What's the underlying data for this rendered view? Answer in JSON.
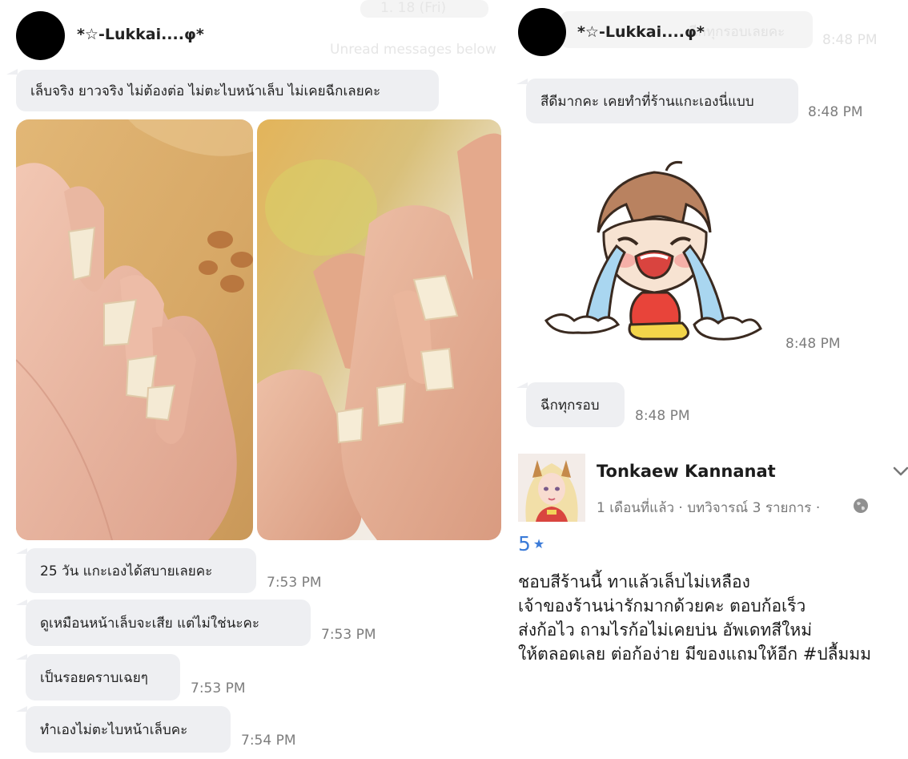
{
  "left_chat": {
    "ghost_date": "1. 18 (Fri)",
    "ghost_unread": "Unread messages below",
    "sender_name": "*☆-Lukkai....φ*",
    "first_message": "เล็บจริง ยาวจริง ไม่ต้องต่อ ไม่ตะไบหน้าเล็บ ไม่เคยฉีกเลยคะ",
    "messages": [
      {
        "text": "25 วัน แกะเองได้สบายเลยคะ",
        "time": "7:53 PM"
      },
      {
        "text": "ดูเหมือนหน้าเล็บจะเสีย แต่ไม่ใช่นะคะ",
        "time": "7:53 PM"
      },
      {
        "text": "เป็นรอยคราบเฉยๆ",
        "time": "7:53 PM"
      },
      {
        "text": "ทำเองไม่ตะไบหน้าเล็บคะ",
        "time": "7:54 PM"
      }
    ]
  },
  "right_chat": {
    "ghost_text": "ฉีกทุกรอบเลยคะ",
    "ghost_time": "8:48 PM",
    "sender_name": "*☆-Lukkai....φ*",
    "messages": [
      {
        "text": "สีดีมากคะ เคยทำที่ร้านแกะเองนี่แบบ",
        "time": "8:48 PM"
      },
      {
        "text": "ฉีกทุกรอบ",
        "time": "8:48 PM"
      }
    ],
    "sticker_time": "8:48 PM"
  },
  "review": {
    "reviewer_name": "Tonkaew Kannanat",
    "meta": "1 เดือนที่แล้ว · บทวิจารณ์ 3 รายการ ·",
    "rating": "5",
    "lines": [
      "ชอบสีร้านนี้ ทาแล้วเล็บไม่เหลือง",
      "เจ้าของร้านน่ารักมากด้วยคะ ตอบก้อเร็ว",
      "ส่งก้อไว ถามไรก้อไม่เคยบ่น อัพเดทสีใหม่",
      "ให้ตลอดเลย ต่อก้อง่าย มีของแถมให้อีก #ปลื้มมม"
    ]
  },
  "icons": {
    "globe": "globe-icon",
    "chevron": "chevron-down-icon",
    "star": "star-icon"
  },
  "colors": {
    "bubble": "#eeeff2",
    "timestamp": "#7d7d7d",
    "rating_blue": "#3b7bd8"
  }
}
